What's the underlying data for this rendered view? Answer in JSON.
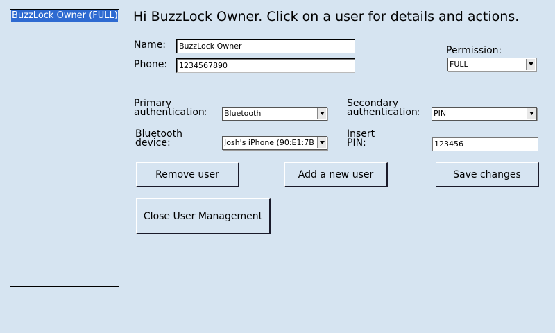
{
  "users": [
    {
      "label": "BuzzLock Owner (FULL)",
      "selected": true
    }
  ],
  "greeting": "Hi BuzzLock Owner. Click on a user for details and actions.",
  "form": {
    "name_label": "Name:",
    "name_value": "BuzzLock Owner",
    "phone_label": "Phone:",
    "phone_value": "1234567890",
    "permission_label": "Permission:",
    "permission_value": "FULL",
    "primary_auth_label_line1": "Primary",
    "primary_auth_label_line2": "authentication:",
    "primary_auth_value": "Bluetooth",
    "secondary_auth_label_line1": "Secondary",
    "secondary_auth_label_line2": "authentication:",
    "secondary_auth_value": "PIN",
    "bt_device_label_line1": "Bluetooth",
    "bt_device_label_line2": "device:",
    "bt_device_value": "Josh's iPhone (90:E1:7B",
    "pin_label_line1": "Insert",
    "pin_label_line2": "PIN:",
    "pin_value": "123456"
  },
  "buttons": {
    "remove": "Remove user",
    "add": "Add a new user",
    "save": "Save changes",
    "close": "Close User Management"
  },
  "colors": {
    "background": "#d6e4f1",
    "selection": "#2e6ad1"
  }
}
